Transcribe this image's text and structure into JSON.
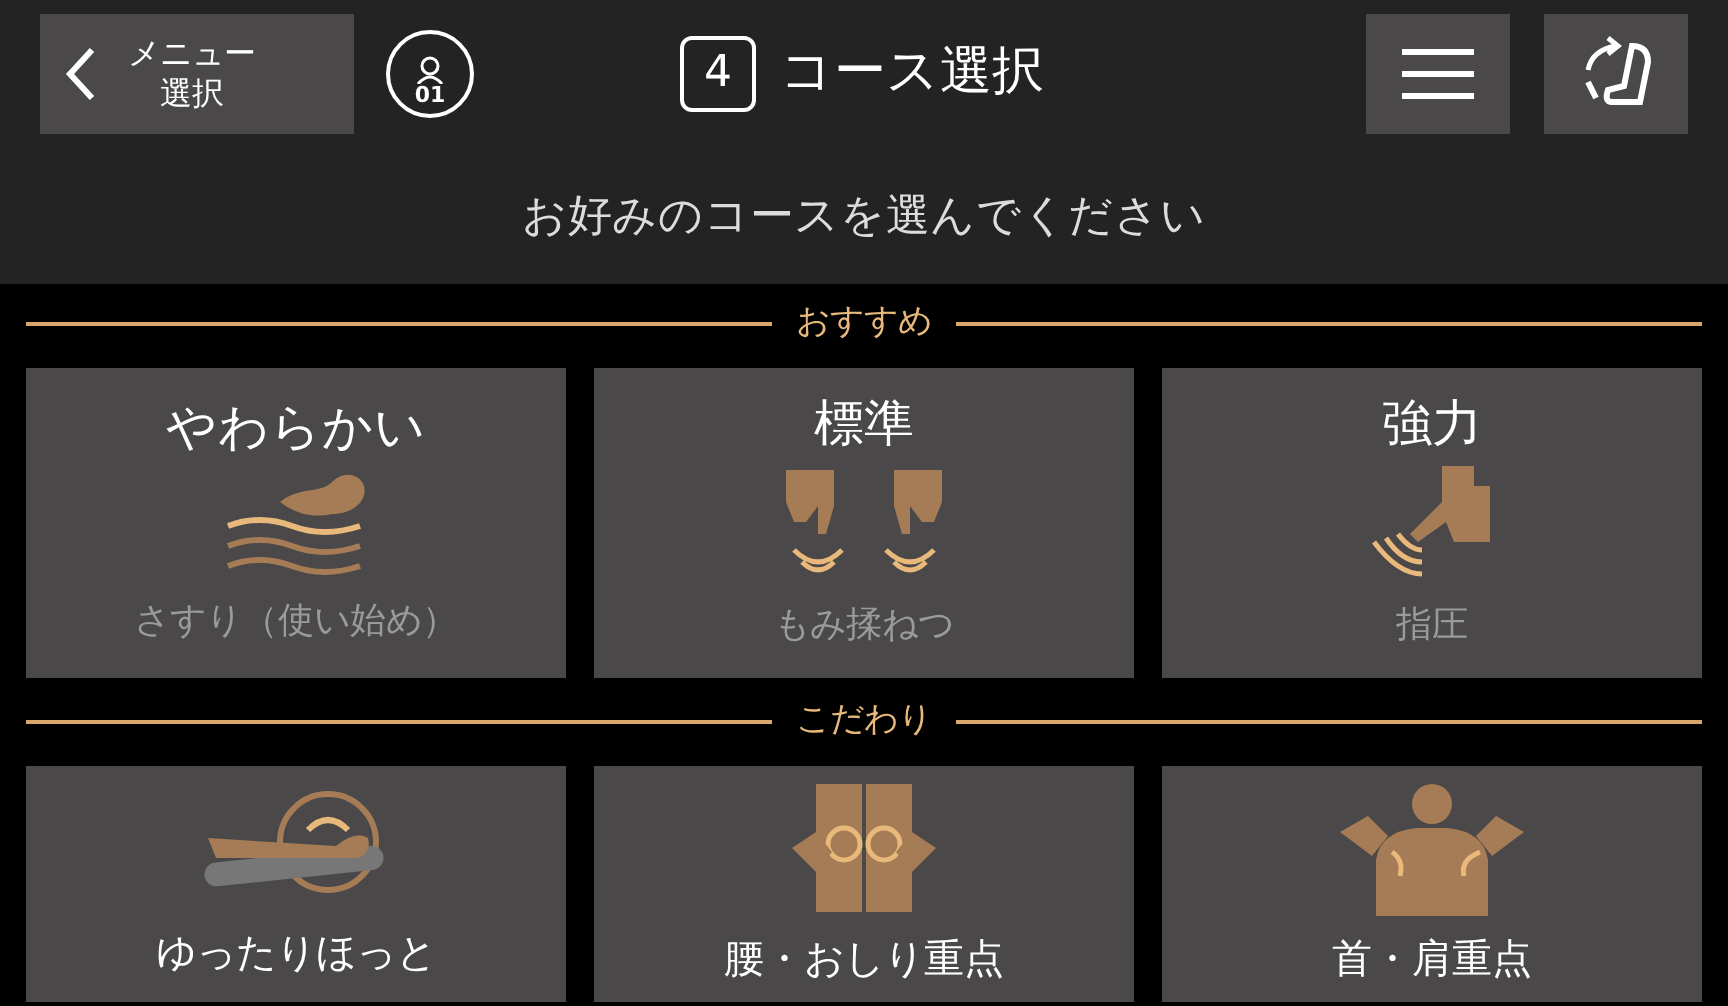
{
  "header": {
    "back_button": {
      "lines": [
        "メニュー",
        "選択"
      ]
    },
    "user_badge": "01",
    "step": "4",
    "title": "コース選択"
  },
  "subtitle": "お好みのコースを選んでください",
  "sections": [
    {
      "title": "おすすめ",
      "courses": [
        {
          "kind": "stroke",
          "name": "やわらかい",
          "caption": "さすり（使い始め）"
        },
        {
          "kind": "knead",
          "name": "標準",
          "caption": "もみ揉ねつ"
        },
        {
          "kind": "press",
          "name": "強力",
          "caption": "指圧"
        }
      ]
    },
    {
      "title": "こだわり",
      "courses": [
        {
          "kind": "recline",
          "name": "ゆったりほっと"
        },
        {
          "kind": "hips",
          "name": "腰・おしり重点"
        },
        {
          "kind": "shoulders",
          "name": "首・肩重点"
        }
      ]
    }
  ]
}
